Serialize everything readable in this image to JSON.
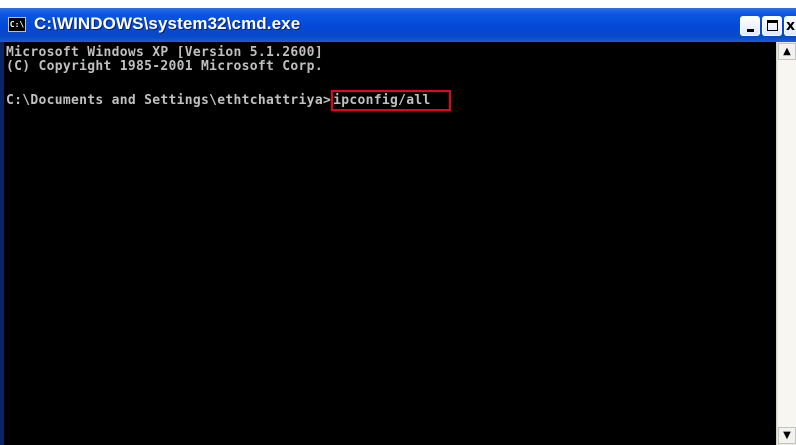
{
  "window": {
    "title": "C:\\WINDOWS\\system32\\cmd.exe",
    "icon": "cmd-icon",
    "icon_text": "C:\\",
    "controls": {
      "minimize": "minimize-icon",
      "maximize": "maximize-icon",
      "close_label": "x"
    }
  },
  "console": {
    "lines": [
      "Microsoft Windows XP [Version 5.1.2600]",
      "(C) Copyright 1985-2001 Microsoft Corp."
    ],
    "prompt": "C:\\Documents and Settings\\ethtchattriya>",
    "command": "ipconfig/all"
  },
  "scrollbar": {
    "up": "▲",
    "down": "▼"
  },
  "colors": {
    "titlebar": "#0348d6",
    "console_bg": "#000000",
    "console_text": "#c0c0c0",
    "highlight_border": "#e8001c"
  }
}
